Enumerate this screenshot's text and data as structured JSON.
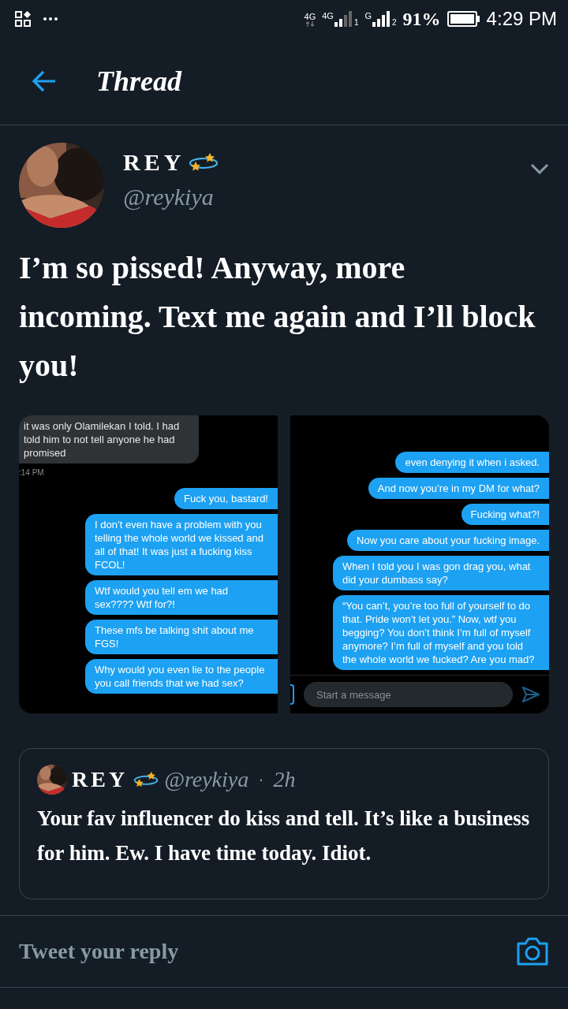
{
  "status_bar": {
    "network_1": "4G",
    "network_2": "4G",
    "sim_1": "1",
    "network_3": "G",
    "sim_2": "2",
    "battery": "91%",
    "time": "4:29 PM"
  },
  "header": {
    "title": "Thread"
  },
  "tweet": {
    "name": "REY",
    "handle": "@reykiya",
    "text": "I’m so pissed! Anyway, more incoming. Text me again and I’ll block you!",
    "images": [
      {
        "messages": [
          {
            "kind": "received",
            "text": "it was only Olamilekan I told. I had told him to not tell anyone he had promised"
          },
          {
            "kind": "timestamp",
            "text": ":14 PM"
          },
          {
            "kind": "sent",
            "text": "Fuck you, bastard!"
          },
          {
            "kind": "sent",
            "text": "I don’t even have a problem with you telling the whole world we kissed and all of that! It was just a fucking kiss FCOL!"
          },
          {
            "kind": "sent",
            "text": "Wtf would you tell em we had sex???? Wtf for?!"
          },
          {
            "kind": "sent",
            "text": "These mfs be talking shit about me FGS!"
          },
          {
            "kind": "sent",
            "text": "Why would you even lie to the people you call friends that we had sex?"
          }
        ]
      },
      {
        "messages": [
          {
            "kind": "sent",
            "text": "even denying it when i asked."
          },
          {
            "kind": "sent",
            "text": "And now you’re in my DM for what?"
          },
          {
            "kind": "sent",
            "text": "Fucking what?!"
          },
          {
            "kind": "sent",
            "text": "Now you care about your fucking image."
          },
          {
            "kind": "sent",
            "text": "When I told you I was gon drag you, what did your dumbass say?"
          },
          {
            "kind": "sent",
            "text": "“You can’t, you’re too full of yourself to do that. Pride won’t let you.” Now, wtf you begging? You don’t think I’m full of myself anymore? I’m full of myself and you told the whole world we fucked? Are you mad?"
          }
        ],
        "composer": {
          "placeholder": "Start a message"
        }
      }
    ]
  },
  "quote": {
    "name": "REY",
    "handle": "@reykiya",
    "separator": "·",
    "age": "2h",
    "text": "Your fav influencer do kiss and tell. It’s like a business for him. Ew. I have time today. Idiot."
  },
  "reply": {
    "placeholder": "Tweet your reply"
  }
}
